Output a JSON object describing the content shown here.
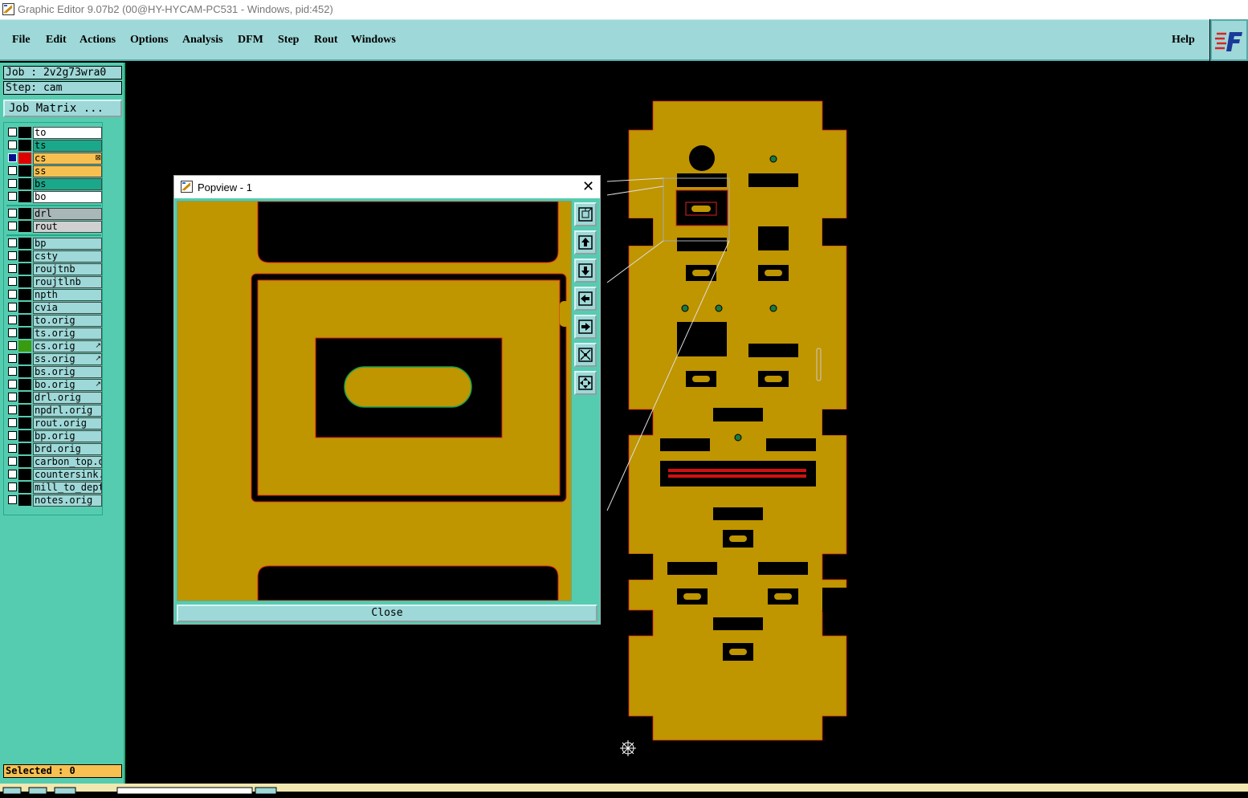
{
  "window": {
    "title": "Graphic Editor 9.07b2 (00@HY-HYCAM-PC531 - Windows, pid:452)"
  },
  "menu": {
    "items": [
      "File",
      "Edit",
      "Actions",
      "Options",
      "Analysis",
      "DFM",
      "Step",
      "Rout",
      "Windows"
    ],
    "help": "Help"
  },
  "job": {
    "job_label": "Job : 2v2g73wra0",
    "step_label": "Step: cam",
    "matrix_button": "Job Matrix ..."
  },
  "layers": [
    {
      "name": "to",
      "color": "#ffffff",
      "swatch": "#000000",
      "checked": false,
      "mark": ""
    },
    {
      "name": "ts",
      "color": "#1aa88a",
      "swatch": "#000000",
      "checked": false,
      "mark": ""
    },
    {
      "name": "cs",
      "color": "#f8c050",
      "swatch": "#e00000",
      "checked": true,
      "mark": "⊠"
    },
    {
      "name": "ss",
      "color": "#f8c050",
      "swatch": "#000000",
      "checked": false,
      "mark": ""
    },
    {
      "name": "bs",
      "color": "#1aa88a",
      "swatch": "#000000",
      "checked": false,
      "mark": ""
    },
    {
      "name": "bo",
      "color": "#ffffff",
      "swatch": "#000000",
      "checked": false,
      "mark": ""
    },
    {
      "name": "drl",
      "color": "#a8b8b8",
      "swatch": "#000000",
      "checked": false,
      "mark": ""
    },
    {
      "name": "rout",
      "color": "#d0d0d0",
      "swatch": "#000000",
      "checked": false,
      "mark": ""
    },
    {
      "name": "bp",
      "color": "#9ed8d8",
      "swatch": "#000000",
      "checked": false,
      "mark": ""
    },
    {
      "name": "csty",
      "color": "#9ed8d8",
      "swatch": "#000000",
      "checked": false,
      "mark": ""
    },
    {
      "name": "roujtnb",
      "color": "#9ed8d8",
      "swatch": "#000000",
      "checked": false,
      "mark": ""
    },
    {
      "name": "roujtlnb",
      "color": "#9ed8d8",
      "swatch": "#000000",
      "checked": false,
      "mark": ""
    },
    {
      "name": "npth",
      "color": "#9ed8d8",
      "swatch": "#000000",
      "checked": false,
      "mark": ""
    },
    {
      "name": "cvia",
      "color": "#9ed8d8",
      "swatch": "#000000",
      "checked": false,
      "mark": ""
    },
    {
      "name": "to.orig",
      "color": "#9ed8d8",
      "swatch": "#000000",
      "checked": false,
      "mark": ""
    },
    {
      "name": "ts.orig",
      "color": "#9ed8d8",
      "swatch": "#000000",
      "checked": false,
      "mark": ""
    },
    {
      "name": "cs.orig",
      "color": "#9ed8d8",
      "swatch": "#3a9a10",
      "checked": false,
      "mark": "↗"
    },
    {
      "name": "ss.orig",
      "color": "#9ed8d8",
      "swatch": "#000000",
      "checked": false,
      "mark": "↗"
    },
    {
      "name": "bs.orig",
      "color": "#9ed8d8",
      "swatch": "#000000",
      "checked": false,
      "mark": ""
    },
    {
      "name": "bo.orig",
      "color": "#9ed8d8",
      "swatch": "#000000",
      "checked": false,
      "mark": "↗"
    },
    {
      "name": "drl.orig",
      "color": "#9ed8d8",
      "swatch": "#000000",
      "checked": false,
      "mark": ""
    },
    {
      "name": "npdrl.orig",
      "color": "#9ed8d8",
      "swatch": "#000000",
      "checked": false,
      "mark": ""
    },
    {
      "name": "rout.orig",
      "color": "#9ed8d8",
      "swatch": "#000000",
      "checked": false,
      "mark": ""
    },
    {
      "name": "bp.orig",
      "color": "#9ed8d8",
      "swatch": "#000000",
      "checked": false,
      "mark": ""
    },
    {
      "name": "brd.orig",
      "color": "#9ed8d8",
      "swatch": "#000000",
      "checked": false,
      "mark": ""
    },
    {
      "name": "carbon_top.orig",
      "color": "#9ed8d8",
      "swatch": "#000000",
      "checked": false,
      "mark": ""
    },
    {
      "name": "countersink.orig",
      "color": "#9ed8d8",
      "swatch": "#000000",
      "checked": false,
      "mark": ""
    },
    {
      "name": "mill_to_depth.orig",
      "color": "#9ed8d8",
      "swatch": "#000000",
      "checked": false,
      "mark": ""
    },
    {
      "name": "notes.orig",
      "color": "#9ed8d8",
      "swatch": "#000000",
      "checked": false,
      "mark": ""
    }
  ],
  "status": {
    "selected": "Selected : 0"
  },
  "popview": {
    "title": "Popview - 1",
    "close_button": "Close",
    "tools": [
      "zoom-window-icon",
      "pan-up-icon",
      "pan-down-icon",
      "pan-left-icon",
      "pan-right-icon",
      "zoom-fit-icon",
      "zoom-home-icon"
    ]
  },
  "colors": {
    "copper": "#bf9500",
    "outline": "#e02020",
    "pad_outline": "#1aa050",
    "panel_bg": "#55ccb0",
    "menu_bg": "#9ed8d8",
    "status_bg": "#f8c050"
  }
}
